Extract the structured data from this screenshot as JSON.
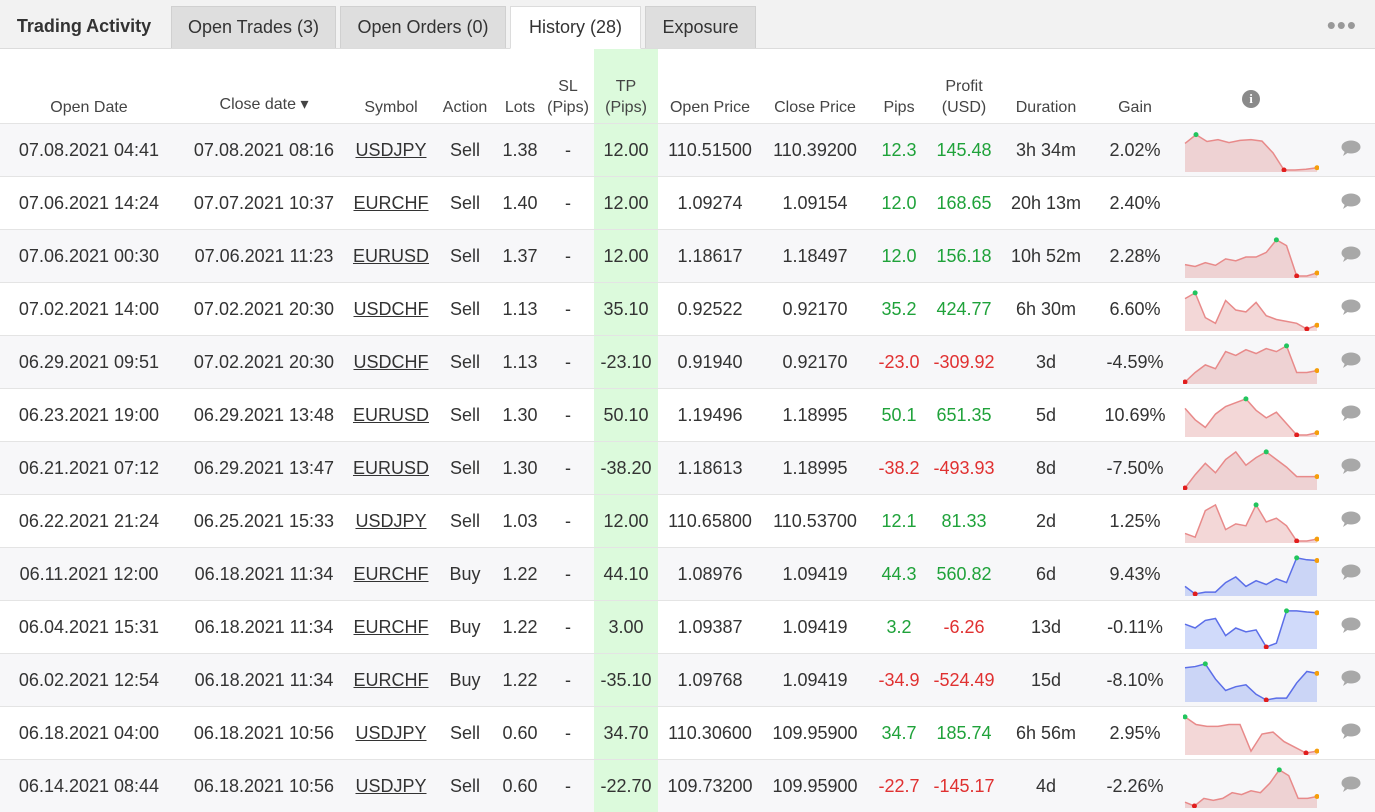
{
  "tabs": {
    "title": "Trading Activity",
    "open_trades": "Open Trades (3)",
    "open_orders": "Open Orders (0)",
    "history": "History (28)",
    "exposure": "Exposure",
    "more": "•••"
  },
  "columns": {
    "open_date": "Open Date",
    "close_date": "Close date ▾",
    "symbol": "Symbol",
    "action": "Action",
    "lots": "Lots",
    "sl_1": "SL",
    "sl_2": "(Pips)",
    "tp_1": "TP",
    "tp_2": "(Pips)",
    "open_price": "Open Price",
    "close_price": "Close Price",
    "pips": "Pips",
    "profit_1": "Profit",
    "profit_2": "(USD)",
    "duration": "Duration",
    "gain": "Gain",
    "info": "i"
  },
  "colors": {
    "positive": "#1fa23a",
    "negative": "#e03131",
    "tp_bg": "#dcfadc",
    "spark_red": "#e88a8a",
    "spark_blue": "#5b6ee8"
  },
  "rows": [
    {
      "open": "07.08.2021 04:41",
      "close": "07.08.2021 08:16",
      "symbol": "USDJPY",
      "action": "Sell",
      "lots": "1.38",
      "sl": "-",
      "tp": "12.00",
      "open_price": "110.51500",
      "close_price": "110.39200",
      "pips": "12.3",
      "profit": "145.48",
      "duration": "3h 34m",
      "gain": "2.02%",
      "sign": "pos",
      "spark_color": "red",
      "spark": [
        0.7,
        0.93,
        0.75,
        0.8,
        0.72,
        0.78,
        0.8,
        0.76,
        0.45,
        0.0,
        0.0,
        0.02,
        0.06
      ],
      "spark_hi": 1,
      "spark_lo": 9
    },
    {
      "open": "07.06.2021 14:24",
      "close": "07.07.2021 10:37",
      "symbol": "EURCHF",
      "action": "Sell",
      "lots": "1.40",
      "sl": "-",
      "tp": "12.00",
      "open_price": "1.09274",
      "close_price": "1.09154",
      "pips": "12.0",
      "profit": "168.65",
      "duration": "20h 13m",
      "gain": "2.40%",
      "sign": "pos",
      "spark_color": "none",
      "spark": [],
      "spark_hi": -1,
      "spark_lo": -1
    },
    {
      "open": "07.06.2021 00:30",
      "close": "07.06.2021 11:23",
      "symbol": "EURUSD",
      "action": "Sell",
      "lots": "1.37",
      "sl": "-",
      "tp": "12.00",
      "open_price": "1.18617",
      "close_price": "1.18497",
      "pips": "12.0",
      "profit": "156.18",
      "duration": "10h 52m",
      "gain": "2.28%",
      "sign": "pos",
      "spark_color": "red",
      "spark": [
        0.3,
        0.25,
        0.35,
        0.28,
        0.45,
        0.4,
        0.5,
        0.5,
        0.62,
        0.95,
        0.8,
        0.0,
        0.0,
        0.08
      ],
      "spark_hi": 9,
      "spark_lo": 11
    },
    {
      "open": "07.02.2021 14:00",
      "close": "07.02.2021 20:30",
      "symbol": "USDCHF",
      "action": "Sell",
      "lots": "1.13",
      "sl": "-",
      "tp": "35.10",
      "open_price": "0.92522",
      "close_price": "0.92170",
      "pips": "35.2",
      "profit": "424.77",
      "duration": "6h 30m",
      "gain": "6.60%",
      "sign": "pos",
      "spark_color": "red",
      "spark": [
        0.8,
        0.95,
        0.3,
        0.15,
        0.75,
        0.5,
        0.45,
        0.7,
        0.35,
        0.25,
        0.2,
        0.15,
        0.0,
        0.1
      ],
      "spark_hi": 1,
      "spark_lo": 12
    },
    {
      "open": "06.29.2021 09:51",
      "close": "07.02.2021 20:30",
      "symbol": "USDCHF",
      "action": "Sell",
      "lots": "1.13",
      "sl": "-",
      "tp": "-23.10",
      "open_price": "0.91940",
      "close_price": "0.92170",
      "pips": "-23.0",
      "profit": "-309.92",
      "duration": "3d",
      "gain": "-4.59%",
      "sign": "neg",
      "spark_color": "red",
      "spark": [
        0.0,
        0.25,
        0.45,
        0.35,
        0.8,
        0.7,
        0.85,
        0.75,
        0.88,
        0.8,
        0.95,
        0.25,
        0.25,
        0.3
      ],
      "spark_hi": 10,
      "spark_lo": 0
    },
    {
      "open": "06.23.2021 19:00",
      "close": "06.29.2021 13:48",
      "symbol": "EURUSD",
      "action": "Sell",
      "lots": "1.30",
      "sl": "-",
      "tp": "50.10",
      "open_price": "1.19496",
      "close_price": "1.18995",
      "pips": "50.1",
      "profit": "651.35",
      "duration": "5d",
      "gain": "10.69%",
      "sign": "pos",
      "spark_color": "red",
      "spark": [
        0.7,
        0.4,
        0.2,
        0.55,
        0.75,
        0.85,
        0.95,
        0.65,
        0.45,
        0.6,
        0.3,
        0.0,
        0.0,
        0.06
      ],
      "spark_hi": 6,
      "spark_lo": 11
    },
    {
      "open": "06.21.2021 07:12",
      "close": "06.29.2021 13:47",
      "symbol": "EURUSD",
      "action": "Sell",
      "lots": "1.30",
      "sl": "-",
      "tp": "-38.20",
      "open_price": "1.18613",
      "close_price": "1.18995",
      "pips": "-38.2",
      "profit": "-493.93",
      "duration": "8d",
      "gain": "-7.50%",
      "sign": "neg",
      "spark_color": "red",
      "spark": [
        0.0,
        0.35,
        0.65,
        0.4,
        0.75,
        0.95,
        0.6,
        0.8,
        0.95,
        0.75,
        0.55,
        0.3,
        0.3,
        0.3
      ],
      "spark_hi": 8,
      "spark_lo": 0
    },
    {
      "open": "06.22.2021 21:24",
      "close": "06.25.2021 15:33",
      "symbol": "USDJPY",
      "action": "Sell",
      "lots": "1.03",
      "sl": "-",
      "tp": "12.00",
      "open_price": "110.65800",
      "close_price": "110.53700",
      "pips": "12.1",
      "profit": "81.33",
      "duration": "2d",
      "gain": "1.25%",
      "sign": "pos",
      "spark_color": "red",
      "spark": [
        0.2,
        0.1,
        0.8,
        0.95,
        0.3,
        0.45,
        0.4,
        0.95,
        0.5,
        0.6,
        0.4,
        0.0,
        0.0,
        0.05
      ],
      "spark_hi": 7,
      "spark_lo": 11
    },
    {
      "open": "06.11.2021 12:00",
      "close": "06.18.2021 11:34",
      "symbol": "EURCHF",
      "action": "Buy",
      "lots": "1.22",
      "sl": "-",
      "tp": "44.10",
      "open_price": "1.08976",
      "close_price": "1.09419",
      "pips": "44.3",
      "profit": "560.82",
      "duration": "6d",
      "gain": "9.43%",
      "sign": "pos",
      "spark_color": "blue",
      "spark": [
        0.2,
        0.0,
        0.05,
        0.05,
        0.3,
        0.45,
        0.2,
        0.35,
        0.25,
        0.4,
        0.3,
        0.95,
        0.9,
        0.88
      ],
      "spark_hi": 11,
      "spark_lo": 1
    },
    {
      "open": "06.04.2021 15:31",
      "close": "06.18.2021 11:34",
      "symbol": "EURCHF",
      "action": "Buy",
      "lots": "1.22",
      "sl": "-",
      "tp": "3.00",
      "open_price": "1.09387",
      "close_price": "1.09419",
      "pips": "3.2",
      "profit": "-6.26",
      "duration": "13d",
      "gain": "-0.11%",
      "sign": "mixed",
      "spark_color": "blue",
      "spark": [
        0.6,
        0.5,
        0.7,
        0.75,
        0.3,
        0.5,
        0.4,
        0.45,
        0.0,
        0.1,
        0.95,
        0.95,
        0.92,
        0.9
      ],
      "spark_hi": 10,
      "spark_lo": 8
    },
    {
      "open": "06.02.2021 12:54",
      "close": "06.18.2021 11:34",
      "symbol": "EURCHF",
      "action": "Buy",
      "lots": "1.22",
      "sl": "-",
      "tp": "-35.10",
      "open_price": "1.09768",
      "close_price": "1.09419",
      "pips": "-34.9",
      "profit": "-524.49",
      "duration": "15d",
      "gain": "-8.10%",
      "sign": "neg",
      "spark_color": "blue",
      "spark": [
        0.85,
        0.88,
        0.95,
        0.55,
        0.25,
        0.35,
        0.4,
        0.15,
        0.0,
        0.05,
        0.05,
        0.45,
        0.75,
        0.7
      ],
      "spark_hi": 2,
      "spark_lo": 8
    },
    {
      "open": "06.18.2021 04:00",
      "close": "06.18.2021 10:56",
      "symbol": "USDJPY",
      "action": "Sell",
      "lots": "0.60",
      "sl": "-",
      "tp": "34.70",
      "open_price": "110.30600",
      "close_price": "109.95900",
      "pips": "34.7",
      "profit": "185.74",
      "duration": "6h 56m",
      "gain": "2.95%",
      "sign": "pos",
      "spark_color": "red",
      "spark": [
        0.95,
        0.75,
        0.7,
        0.7,
        0.75,
        0.75,
        0.05,
        0.5,
        0.55,
        0.3,
        0.15,
        0.0,
        0.05
      ],
      "spark_hi": 0,
      "spark_lo": 11
    },
    {
      "open": "06.14.2021 08:44",
      "close": "06.18.2021 10:56",
      "symbol": "USDJPY",
      "action": "Sell",
      "lots": "0.60",
      "sl": "-",
      "tp": "-22.70",
      "open_price": "109.73200",
      "close_price": "109.95900",
      "pips": "-22.7",
      "profit": "-145.17",
      "duration": "4d",
      "gain": "-2.26%",
      "sign": "neg",
      "spark_color": "red",
      "spark": [
        0.1,
        0.0,
        0.2,
        0.15,
        0.2,
        0.35,
        0.3,
        0.4,
        0.35,
        0.6,
        0.95,
        0.8,
        0.2,
        0.2,
        0.25
      ],
      "spark_hi": 10,
      "spark_lo": 1
    }
  ]
}
